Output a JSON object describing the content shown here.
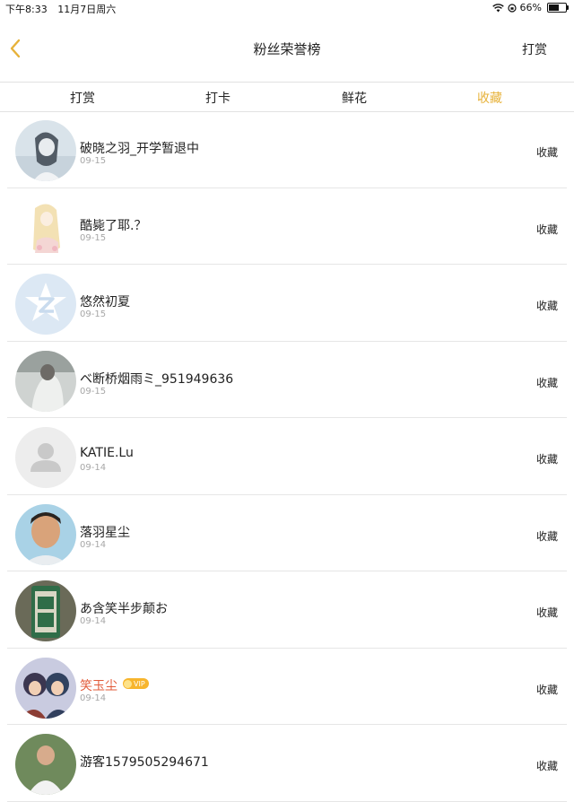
{
  "status": {
    "time": "下午8:33",
    "date": "11月7日周六",
    "battery": "66%",
    "battery_level": 0.66
  },
  "nav": {
    "title": "粉丝荣誉榜",
    "right_label": "打赏"
  },
  "tabs": [
    {
      "label": "打赏"
    },
    {
      "label": "打卡"
    },
    {
      "label": "鲜花"
    },
    {
      "label": "收藏"
    }
  ],
  "active_tab": 3,
  "fans": [
    {
      "name": "破晓之羽_开学暂退中",
      "date": "09-15",
      "action": "收藏"
    },
    {
      "name": "酷毙了耶.？",
      "date": "09-15",
      "action": "收藏"
    },
    {
      "name": "悠然初夏",
      "date": "09-15",
      "action": "收藏"
    },
    {
      "name": "ベ断桥烟雨ミ_951949636",
      "date": "09-15",
      "action": "收藏"
    },
    {
      "name": "KATIE.Lu",
      "date": "09-14",
      "action": "收藏"
    },
    {
      "name": "落羽星尘",
      "date": "09-14",
      "action": "收藏"
    },
    {
      "name": "あ含笑半步颠お",
      "date": "09-14",
      "action": "收藏"
    },
    {
      "name": "笑玉尘",
      "date": "09-14",
      "action": "收藏",
      "vip": "VIP"
    },
    {
      "name": "游客1579505294671",
      "date": "",
      "action": "收藏"
    }
  ],
  "colors": {
    "accent": "#e7b23a",
    "vip_name": "#e25b3a"
  }
}
